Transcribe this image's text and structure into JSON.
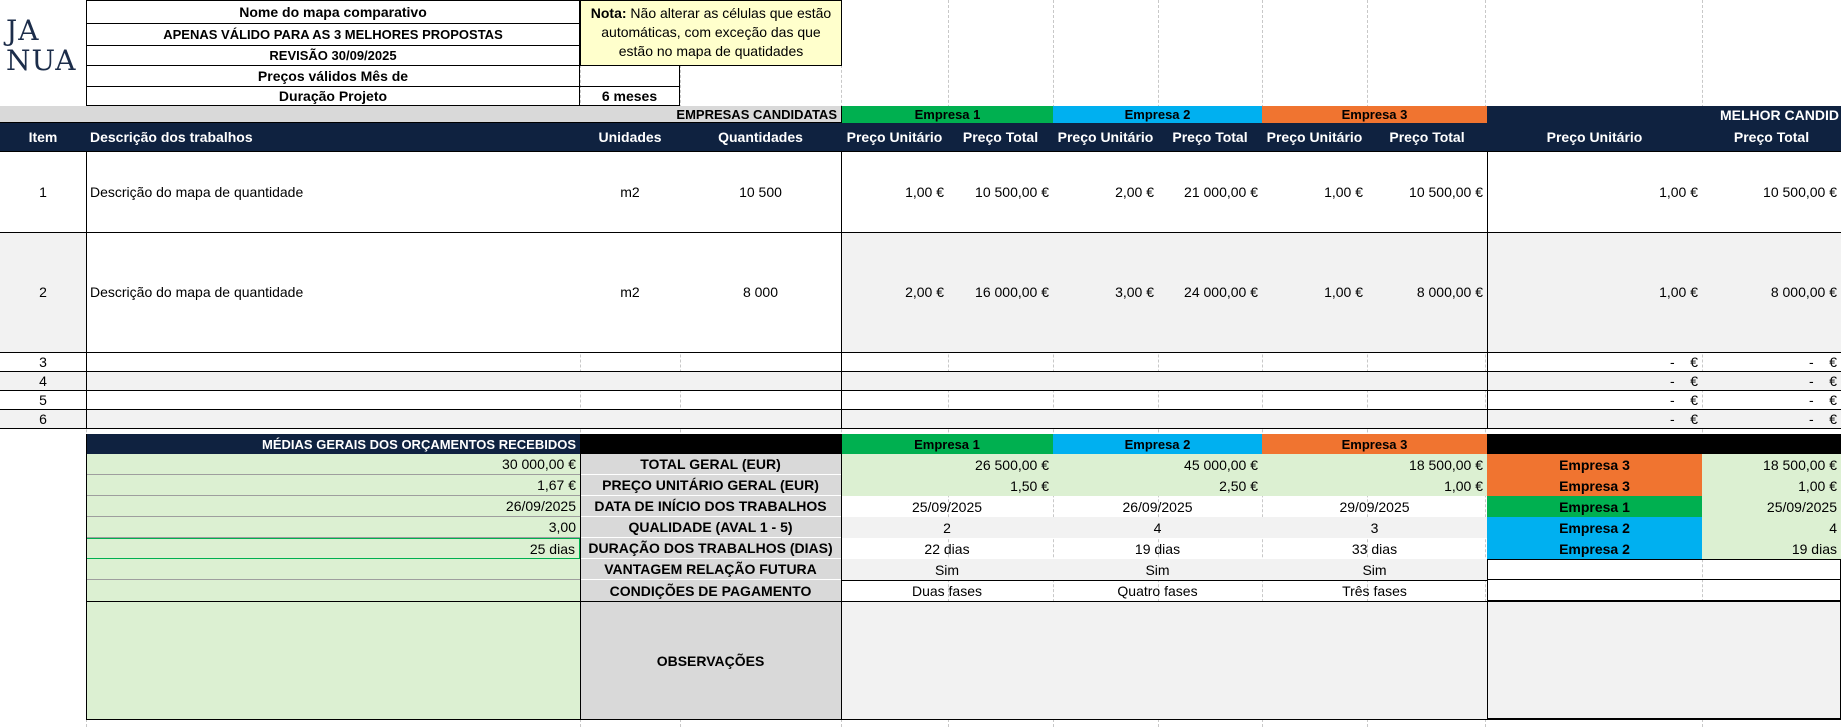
{
  "logo": {
    "line1": "JA",
    "line2": "NUA"
  },
  "header": {
    "title": "Nome do mapa comparativo",
    "subtitle": "APENAS VÁLIDO PARA AS 3 MELHORES PROPOSTAS",
    "revision": "REVISÃO 30/09/2025",
    "prices_valid": "Preços válidos Mês de",
    "duration_label": "Duração Projeto",
    "duration_value": "6 meses",
    "note_bold": "Nota:",
    "note_text": " Não alterar as células que estão automáticas, com exceção das que estão no mapa de quatidades"
  },
  "band": {
    "candidates": "EMPRESAS CANDIDATAS",
    "company1": "Empresa 1",
    "company2": "Empresa 2",
    "company3": "Empresa 3",
    "best": "MELHOR CANDID"
  },
  "columns": {
    "item": "Item",
    "description": "Descrição dos trabalhos",
    "units": "Unidades",
    "quantities": "Quantidades",
    "unit_price": "Preço Unitário",
    "total_price": "Preço Total"
  },
  "rows": [
    {
      "item": "1",
      "desc": "Descrição do mapa de quantidade",
      "unit": "m2",
      "qty": "10 500",
      "c1u": "1,00 €",
      "c1t": "10 500,00 €",
      "c2u": "2,00 €",
      "c2t": "21 000,00 €",
      "c3u": "1,00 €",
      "c3t": "10 500,00 €",
      "bu": "1,00 €",
      "bt": "10 500,00 €"
    },
    {
      "item": "2",
      "desc": "Descrição do mapa de quantidade",
      "unit": "m2",
      "qty": "8 000",
      "c1u": "2,00 €",
      "c1t": "16 000,00 €",
      "c2u": "3,00 €",
      "c2t": "24 000,00 €",
      "c3u": "1,00 €",
      "c3t": "8 000,00 €",
      "bu": "1,00 €",
      "bt": "8 000,00 €"
    }
  ],
  "empty_rows": [
    {
      "item": "3",
      "bu": "-    €",
      "bt": "-    €"
    },
    {
      "item": "4",
      "bu": "-    €",
      "bt": "-    €"
    },
    {
      "item": "5",
      "bu": "-    €",
      "bt": "-    €"
    },
    {
      "item": "6",
      "bu": "-    €",
      "bt": "-    €"
    }
  ],
  "summary": {
    "averages_title": "MÉDIAS GERAIS DOS ORÇAMENTOS RECEBIDOS",
    "company1": "Empresa 1",
    "company2": "Empresa 2",
    "company3": "Empresa 3",
    "rows": [
      {
        "avg": "30 000,00 €",
        "label": "TOTAL GERAL (EUR)",
        "c1": "26 500,00 €",
        "c2": "45 000,00 €",
        "c3": "18 500,00 €",
        "best": "Empresa 3",
        "bestval": "18 500,00 €"
      },
      {
        "avg": "1,67 €",
        "label": "PREÇO UNITÁRIO GERAL (EUR)",
        "c1": "1,50 €",
        "c2": "2,50 €",
        "c3": "1,00 €",
        "best": "Empresa 3",
        "bestval": "1,00 €"
      },
      {
        "avg": "26/09/2025",
        "label": "DATA DE INÍCIO DOS TRABALHOS",
        "c1": "25/09/2025",
        "c2": "26/09/2025",
        "c3": "29/09/2025",
        "best": "Empresa 1",
        "bestval": "25/09/2025"
      },
      {
        "avg": "3,00",
        "label": "QUALIDADE (AVAL 1 - 5)",
        "c1": "2",
        "c2": "4",
        "c3": "3",
        "best": "Empresa 2",
        "bestval": "4"
      },
      {
        "avg": "25 dias",
        "label": "DURAÇÃO DOS TRABALHOS (DIAS)",
        "c1": "22 dias",
        "c2": "19 dias",
        "c3": "33 dias",
        "best": "Empresa 2",
        "bestval": "19 dias"
      },
      {
        "avg": "",
        "label": "VANTAGEM RELAÇÃO FUTURA",
        "c1": "Sim",
        "c2": "Sim",
        "c3": "Sim",
        "best": "",
        "bestval": ""
      },
      {
        "avg": "",
        "label": "CONDIÇÕES DE PAGAMENTO",
        "c1": "Duas fases",
        "c2": "Quatro fases",
        "c3": "Três fases",
        "best": "",
        "bestval": ""
      }
    ],
    "observations": "OBSERVAÇÕES"
  },
  "colors": {
    "navy": "#0f2240",
    "green": "#00b050",
    "blue": "#00b0f0",
    "orange": "#f07430",
    "light_green": "#dcf0d2",
    "gray": "#d9d9d9"
  }
}
